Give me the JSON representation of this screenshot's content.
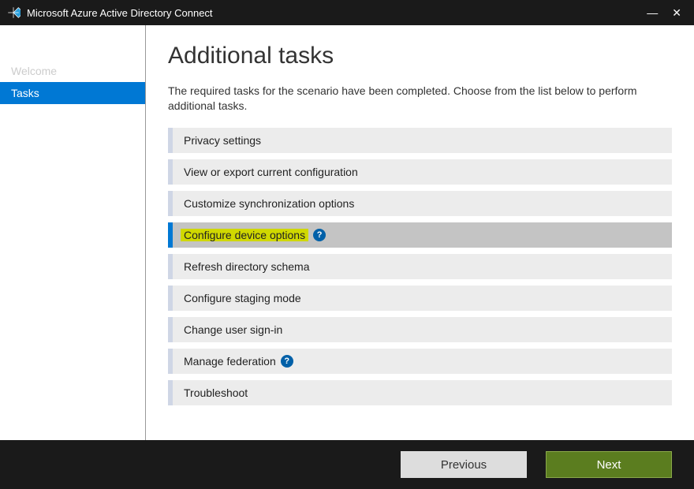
{
  "window": {
    "title": "Microsoft Azure Active Directory Connect"
  },
  "sidebar": {
    "items": [
      {
        "label": "Welcome",
        "active": false
      },
      {
        "label": "Tasks",
        "active": true
      }
    ]
  },
  "page": {
    "title": "Additional tasks",
    "description": "The required tasks for the scenario have been completed. Choose from the list below to perform additional tasks."
  },
  "tasks": [
    {
      "label": "Privacy settings",
      "selected": false,
      "hasHelp": false
    },
    {
      "label": "View or export current configuration",
      "selected": false,
      "hasHelp": false
    },
    {
      "label": "Customize synchronization options",
      "selected": false,
      "hasHelp": false
    },
    {
      "label": "Configure device options",
      "selected": true,
      "hasHelp": true
    },
    {
      "label": "Refresh directory schema",
      "selected": false,
      "hasHelp": false
    },
    {
      "label": "Configure staging mode",
      "selected": false,
      "hasHelp": false
    },
    {
      "label": "Change user sign-in",
      "selected": false,
      "hasHelp": false
    },
    {
      "label": "Manage federation",
      "selected": false,
      "hasHelp": true
    },
    {
      "label": "Troubleshoot",
      "selected": false,
      "hasHelp": false
    }
  ],
  "footer": {
    "previous_label": "Previous",
    "next_label": "Next"
  },
  "help_glyph": "?"
}
